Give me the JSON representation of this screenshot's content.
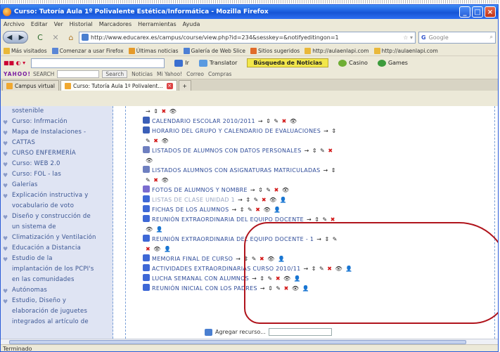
{
  "window": {
    "title": "Curso: Tutoría Aula 1º Polivalente Estética/Informática - Mozilla Firefox",
    "controls": [
      "_",
      "□",
      "×"
    ]
  },
  "menu": [
    "Archivo",
    "Editar",
    "Ver",
    "Historial",
    "Marcadores",
    "Herramientas",
    "Ayuda"
  ],
  "nav": {
    "back_icon": "back-arrow-icon",
    "url": "http://www.educarex.es/campus/course/view.php?id=234&sesskey=&notifyeditingon=1",
    "search_engine": "G",
    "search_placeholder": "Google"
  },
  "bookmarks": [
    "Más visitados",
    "Comenzar a usar Firefox",
    "Últimas noticias",
    "Galería de Web Slice",
    "Sitios sugeridos",
    "http://aulaenlapi.com",
    "http://aulaenlapi.com"
  ],
  "toolbar2": {
    "buttons": [
      "Ir",
      "Translator"
    ],
    "hot": "Búsqueda de Noticias",
    "extras": [
      "Casino",
      "Games"
    ]
  },
  "yahoo": {
    "logo": "YAHOO!",
    "search_label": "SEARCH",
    "button": "Search",
    "links": [
      "Noticias",
      "Mi Yahoo!",
      "Correo",
      "Compras"
    ]
  },
  "tabs": [
    {
      "label": "Campus virtual",
      "active": false
    },
    {
      "label": "Curso: Tutoría Aula 1º Polivalent...",
      "active": true
    }
  ],
  "sidebar": [
    "sostenible",
    "Curso: Infrmación",
    "Mapa de Instalaciones -",
    "CATTAS",
    "CURSO ENFERMERÍA",
    "Curso: WEB 2.0",
    "Curso: FOL - las",
    "Galerías",
    "Explicación instructiva y",
    "vocabulario de voto",
    "Diseño y construcción de",
    "un sistema de",
    "Climatización y Ventilación",
    "Educación a Distancia",
    "Estudio de la",
    "implantación de los PCPI's",
    "en las comunidades",
    "Autónomas",
    "Estudio, Diseño y",
    "elaboración de juguetes",
    "integrados al artículo de"
  ],
  "rows": [
    {
      "text": "",
      "actions": "→ ⇕ ✖ 👁",
      "icon": "arrow",
      "dim": false
    },
    {
      "text": "CALENDARIO ESCOLAR 2010/2011",
      "actions": "→ ⇕ ✎ ✖ 👁",
      "icon": "doc",
      "dim": false
    },
    {
      "text": "HORARIO DEL GRUPO Y CALENDARIO DE EVALUACIONES",
      "actions": "→ ⇕",
      "icon": "doc",
      "dim": false
    },
    {
      "text": "",
      "actions": "✎ ✖ 👁",
      "icon": "none",
      "dim": false
    },
    {
      "text": "LISTADOS DE ALUMNOS CON DATOS PERSONALES",
      "actions": "→ ⇕ ✎ ✖",
      "icon": "db",
      "dim": false
    },
    {
      "text": "",
      "actions": "👁",
      "icon": "none",
      "dim": false
    },
    {
      "text": "LISTADOS ALUMNOS CON ASIGNATURAS MATRICULADAS",
      "actions": "→ ⇕",
      "icon": "db",
      "dim": false
    },
    {
      "text": "",
      "actions": "✎ ✖ 👁",
      "icon": "none",
      "dim": false
    },
    {
      "text": "FOTOS DE ALUMNOS Y NOMBRE",
      "actions": "→ ⇕ ✎ ✖ 👁",
      "icon": "photo",
      "dim": false
    },
    {
      "text": "LISTAS DE CLASE UNIDAD 1",
      "actions": "→ ⇕ ✎ ✖ 👁 👤",
      "icon": "forum",
      "dim": true
    },
    {
      "text": "FICHAS DE LOS ALUMNOS",
      "actions": "→ ⇕ ✎ ✖ 👁 👤",
      "icon": "forum",
      "dim": false
    },
    {
      "text": "REUNIÓN EXTRAORDINARIA DEL EQUIPO DOCENTE",
      "actions": "→ ⇕ ✎ ✖",
      "icon": "forum",
      "dim": false
    },
    {
      "text": "",
      "actions": "👁 👤",
      "icon": "none",
      "dim": false
    },
    {
      "text": "REUNIÓN EXTRAORDINARIA DEL EQUIPO DOCENTE - 1",
      "actions": "→ ⇕ ✎",
      "icon": "forum",
      "dim": false
    },
    {
      "text": "",
      "actions": "✖ 👁 👤",
      "icon": "none",
      "dim": false
    },
    {
      "text": "MEMORIA FINAL DE CURSO",
      "actions": "→ ⇕ ✎ ✖ 👁 👤",
      "icon": "forum",
      "dim": false
    },
    {
      "text": "ACTIVIDADES EXTRAORDINARIAS CURSO 2010/11",
      "actions": "→ ⇕ ✎ ✖ 👁 👤",
      "icon": "forum",
      "dim": false
    },
    {
      "text": "LUCHA SEMANAL CON ALUMNOS",
      "actions": "→ ⇕ ✎ ✖ 👁 👤",
      "icon": "forum",
      "dim": false
    },
    {
      "text": "REUNIÓN INICIAL CON LOS PADRES",
      "actions": "→ ⇕ ✎ ✖ 👁 👤",
      "icon": "forum",
      "dim": false
    }
  ],
  "add_resource": "Agregar recurso...",
  "status": "Terminado"
}
